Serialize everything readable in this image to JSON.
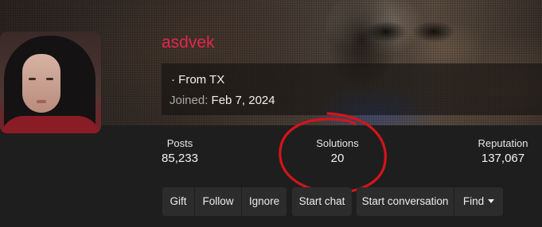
{
  "profile": {
    "username": "asdvek",
    "location": "· From TX",
    "joined_label": "Joined:",
    "joined_date": "Feb 7, 2024"
  },
  "stats": {
    "posts_label": "Posts",
    "posts_value": "85,233",
    "solutions_label": "Solutions",
    "solutions_value": "20",
    "reputation_label": "Reputation",
    "reputation_value": "137,067"
  },
  "actions": {
    "gift": "Gift",
    "follow": "Follow",
    "ignore": "Ignore",
    "start_chat": "Start chat",
    "start_conversation": "Start conversation",
    "find": "Find"
  },
  "colors": {
    "username": "#e0284a",
    "annotation_circle": "#d4141c",
    "button_bg": "#2c2c2c",
    "page_bg": "#1e1e1e"
  },
  "icons": {
    "find_caret": "caret-down-icon"
  }
}
